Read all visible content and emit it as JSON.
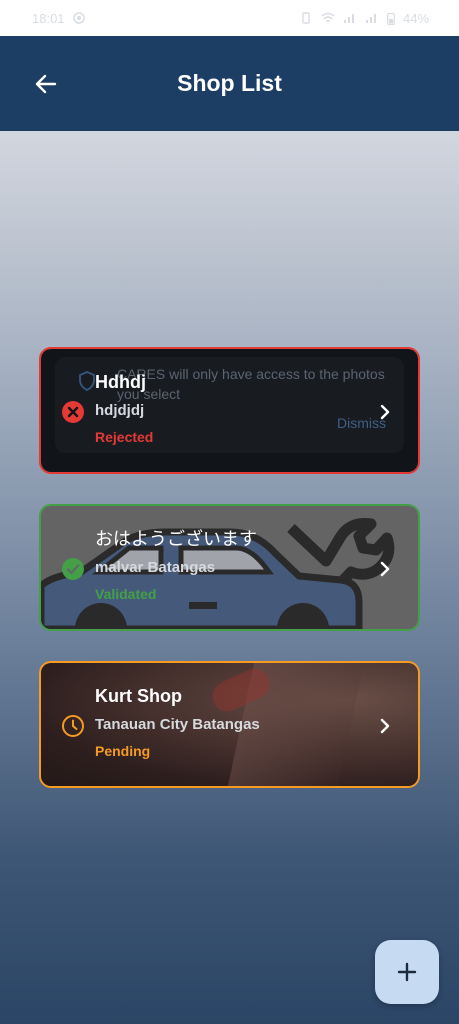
{
  "status_bar": {
    "time": "18:01",
    "battery": "44%"
  },
  "app_bar": {
    "title": "Shop List"
  },
  "shops": [
    {
      "name": "Hdhdj",
      "address": "hdjdjdj",
      "status": "Rejected",
      "status_color": "#e53935",
      "status_icon": "x-circle-icon"
    },
    {
      "name": "おはようございます",
      "address": "malvar Batangas",
      "status": "Validated",
      "status_color": "#43a047",
      "status_icon": "check-circle-icon"
    },
    {
      "name": "Kurt Shop",
      "address": "Tanauan City Batangas",
      "status": "Pending",
      "status_color": "#f59a23",
      "status_icon": "clock-icon"
    }
  ],
  "photo_permission_overlay": {
    "message": "CARES will only have access to the photos you select",
    "dismiss_label": "Dismiss"
  },
  "fab": {
    "icon": "plus-icon"
  }
}
